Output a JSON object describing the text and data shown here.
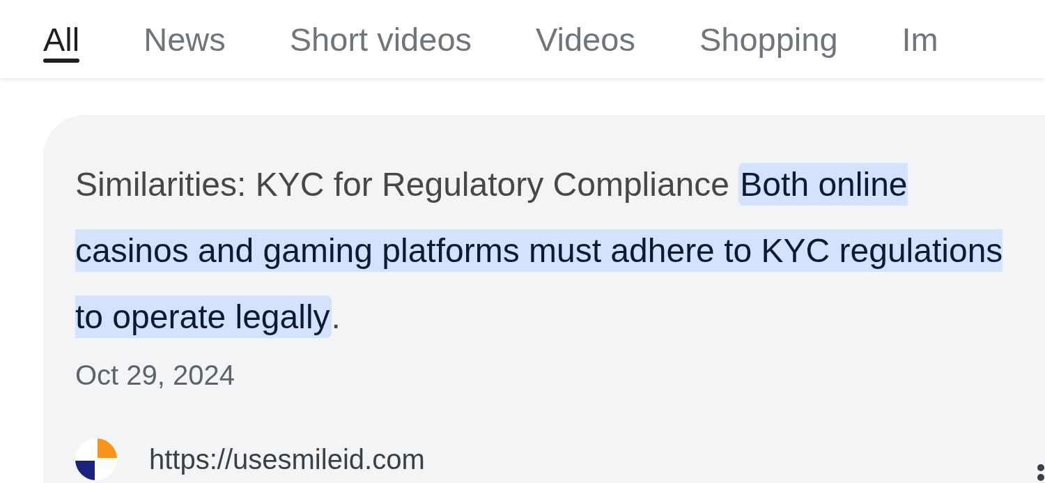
{
  "tabs": [
    {
      "label": "All",
      "selected": true
    },
    {
      "label": "News",
      "selected": false
    },
    {
      "label": "Short videos",
      "selected": false
    },
    {
      "label": "Videos",
      "selected": false
    },
    {
      "label": "Shopping",
      "selected": false
    },
    {
      "label": "Im",
      "selected": false
    }
  ],
  "result": {
    "snippet": "Similarities: KYC for Regulatory Compliance **Both online casinos and gaming platforms must adhere to KYC regulations to operate legally**.",
    "date": "Oct 29, 2024",
    "source_url": "https://usesmileid.com"
  }
}
